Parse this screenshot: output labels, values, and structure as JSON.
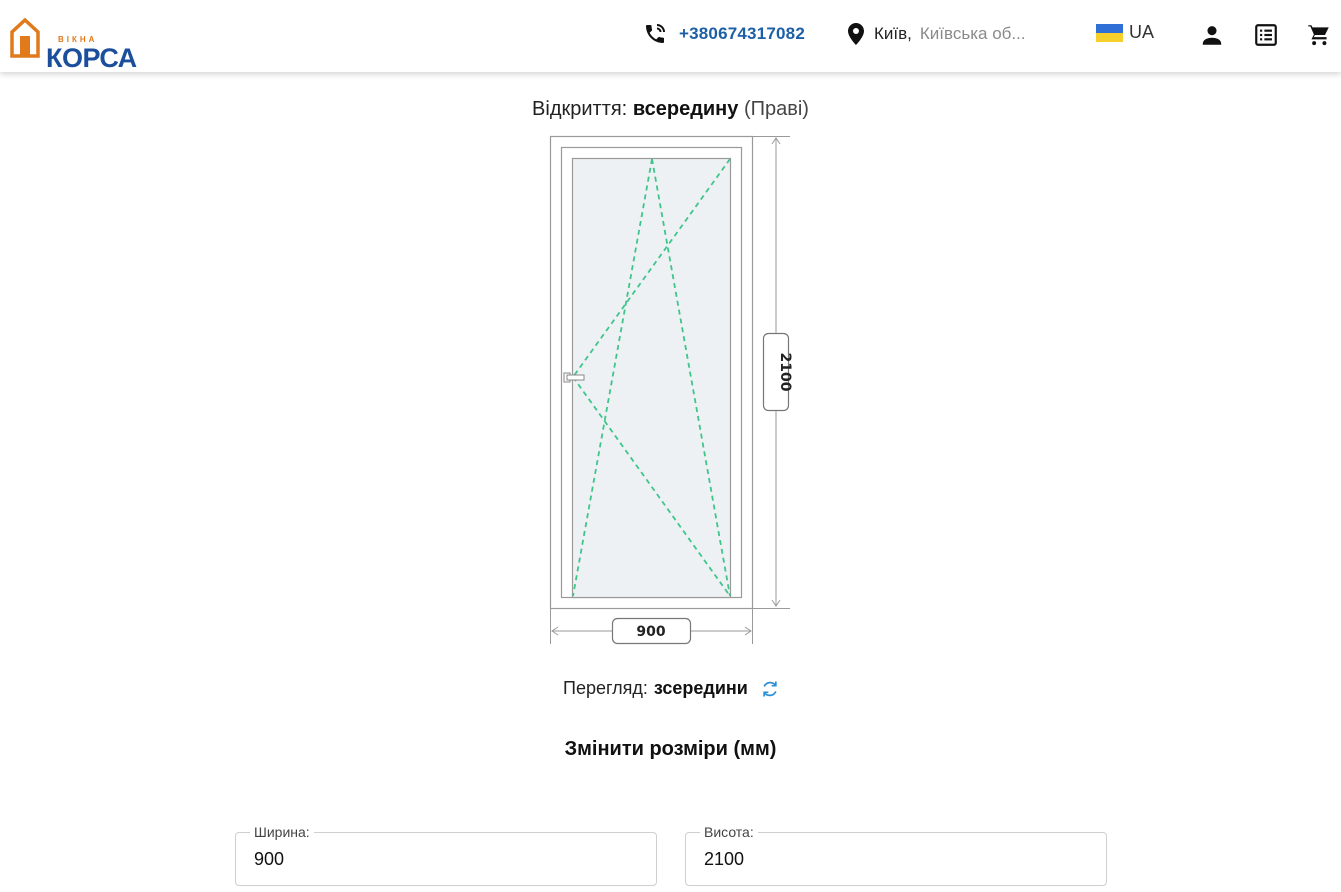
{
  "header": {
    "logo_small": "ВІКНА",
    "logo_text": "КОРСА",
    "phone": "+380674317082",
    "city": "Київ,",
    "region": "Київська об...",
    "language": "UA",
    "icons": [
      "phone-icon",
      "location-pin-icon",
      "ukraine-flag-icon",
      "user-icon",
      "list-icon",
      "cart-icon"
    ]
  },
  "opening": {
    "label": "Відкриття:",
    "value": "всередину",
    "side": "(Праві)"
  },
  "diagram": {
    "width_label": "900",
    "height_label": "2100",
    "glass_color": "#eef1f4",
    "sash_line_color": "#3fc58a"
  },
  "view": {
    "label": "Перегляд:",
    "value": "зсередини"
  },
  "resize": {
    "title": "Змінити розміри (мм)"
  },
  "fields": {
    "width_label": "Ширина:",
    "width_value": "900",
    "height_label": "Висота:",
    "height_value": "2100"
  }
}
